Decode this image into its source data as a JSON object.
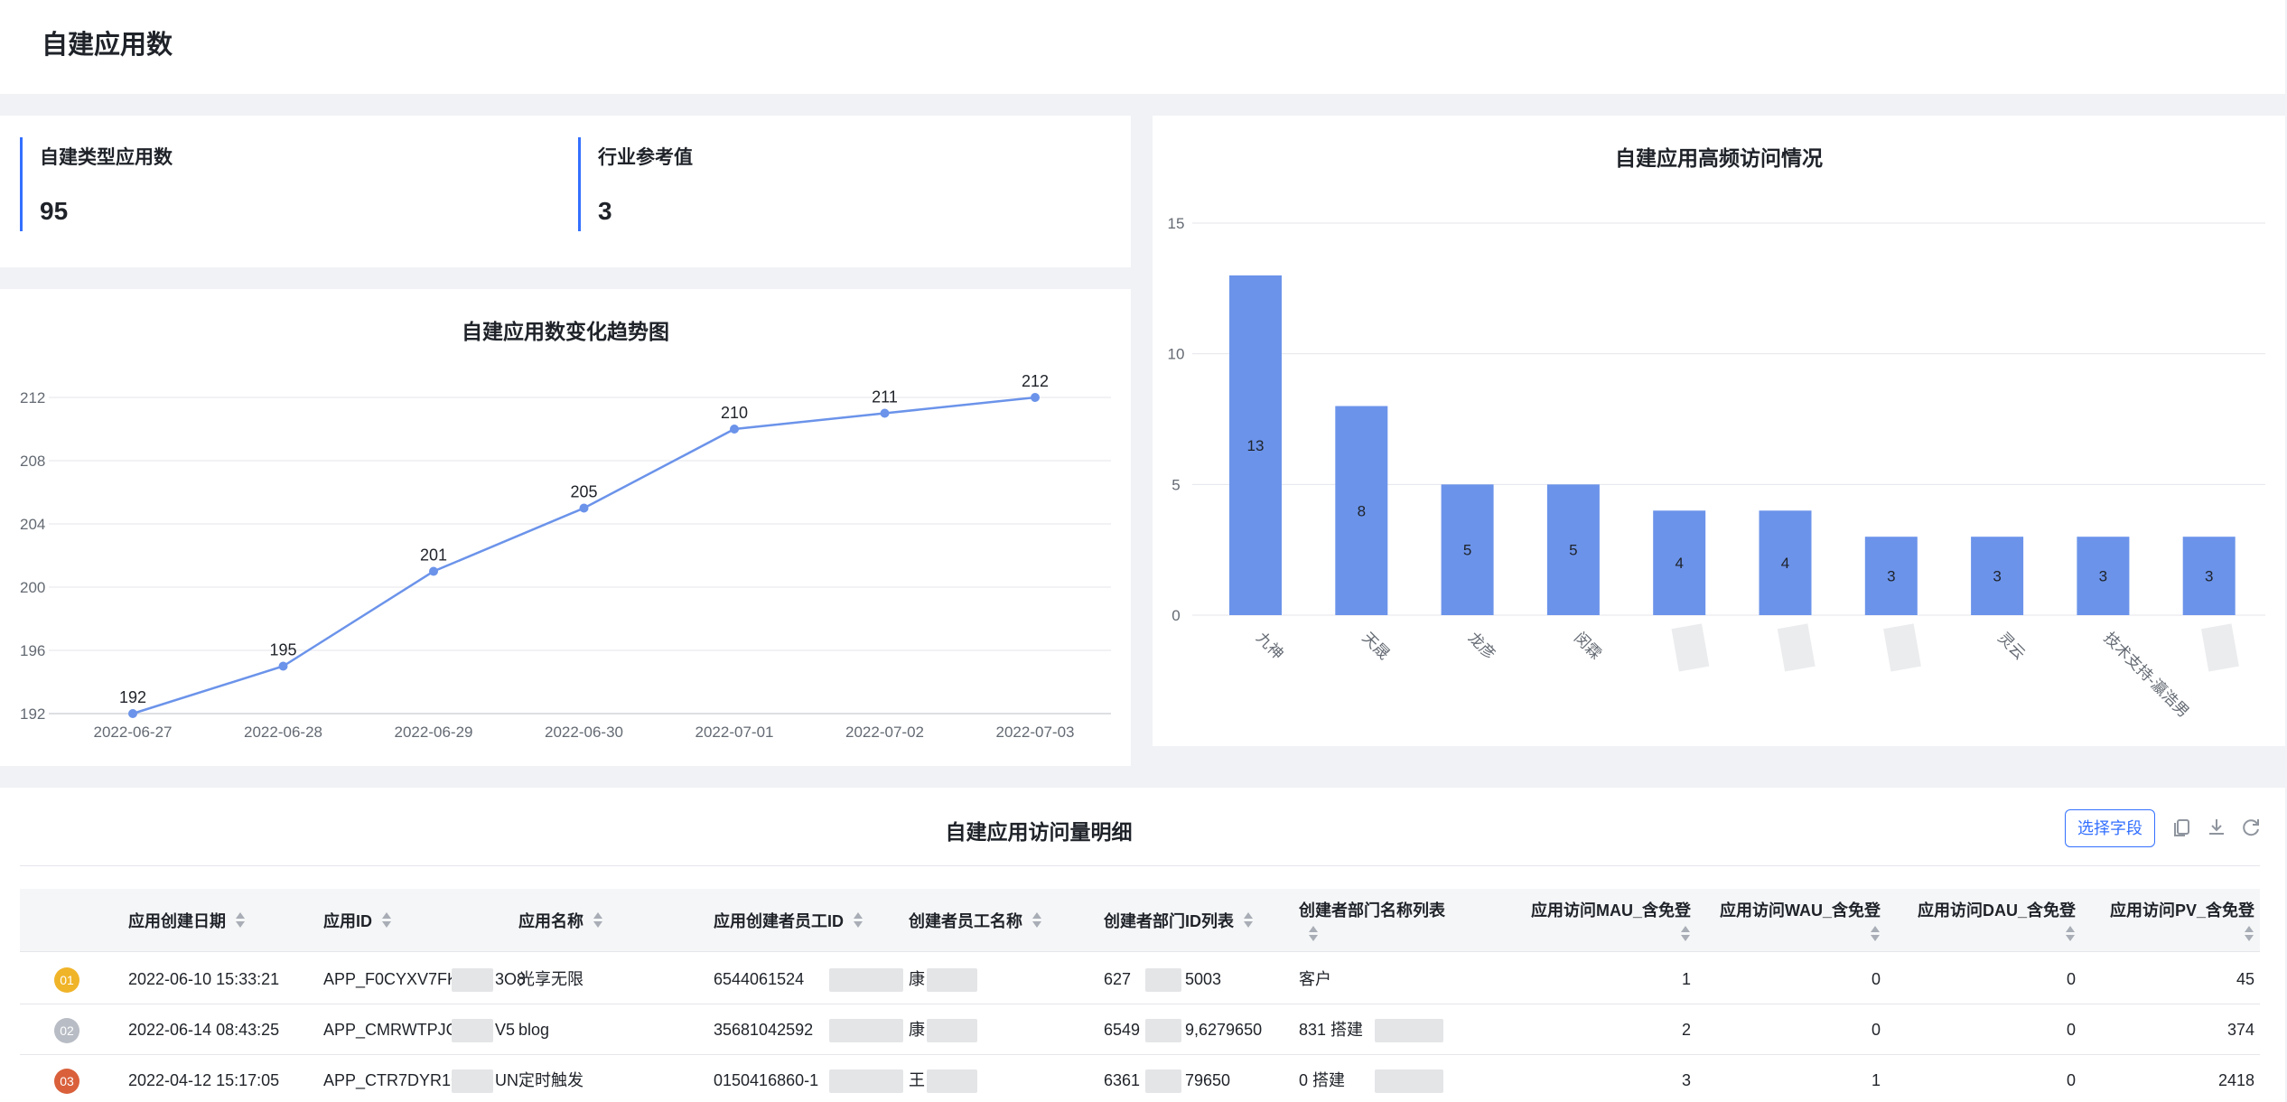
{
  "header": {
    "title": "自建应用数"
  },
  "kpis": [
    {
      "label": "自建类型应用数",
      "value": "95"
    },
    {
      "label": "行业参考值",
      "value": "3"
    }
  ],
  "line_chart": {
    "title": "自建应用数变化趋势图",
    "chart_data": {
      "type": "line",
      "x": [
        "2022-06-27",
        "2022-06-28",
        "2022-06-29",
        "2022-06-30",
        "2022-07-01",
        "2022-07-02",
        "2022-07-03"
      ],
      "values": [
        192,
        195,
        201,
        205,
        210,
        211,
        212
      ],
      "y_ticks": [
        192,
        196,
        200,
        204,
        208,
        212
      ],
      "ylim": [
        192,
        212
      ],
      "grid": true,
      "color": "#6b93ea"
    }
  },
  "bar_chart": {
    "title": "自建应用高频访问情况",
    "chart_data": {
      "type": "bar",
      "categories": [
        "九神",
        "天晟",
        "龙彦",
        "闵霖",
        "",
        "",
        "",
        "灵云",
        "技术支持-瀛浩男",
        ""
      ],
      "values": [
        13,
        8,
        5,
        5,
        4,
        4,
        3,
        3,
        3,
        3
      ],
      "y_ticks": [
        0,
        5,
        10,
        15
      ],
      "ylim": [
        0,
        15
      ],
      "grid": true,
      "color": "#6b93ea"
    }
  },
  "table": {
    "title": "自建应用访问量明细",
    "select_button": "选择字段",
    "icons": [
      "copy-icon",
      "download-icon",
      "refresh-icon"
    ],
    "columns": [
      "应用创建日期",
      "应用ID",
      "应用名称",
      "应用创建者员工ID",
      "创建者员工名称",
      "创建者部门ID列表",
      "创建者部门名称列表",
      "应用访问MAU_含免登",
      "应用访问WAU_含免登",
      "应用访问DAU_含免登",
      "应用访问PV_含免登"
    ],
    "rows": [
      {
        "rank": "01",
        "rank_color": "#f0b429",
        "date": "2022-06-10 15:33:21",
        "app_id": "APP_F0CYXV7FK",
        "app_id_tail": "3O8",
        "name": "光享无限",
        "creator_id": "6544061524",
        "creator_name": "康",
        "dept_id": "627",
        "dept_id_tail": "5003",
        "dept_name": "客户",
        "mau": "1",
        "wau": "0",
        "dau": "0",
        "pv": "45"
      },
      {
        "rank": "02",
        "rank_color": "#b8bcc4",
        "date": "2022-06-14 08:43:25",
        "app_id": "APP_CMRWTPJGS",
        "app_id_tail": "V5",
        "name": "blog",
        "creator_id": "35681042592",
        "creator_name": "康",
        "dept_id": "6549",
        "dept_id_tail": "9,6279650",
        "dept_name": "831 搭建",
        "mau": "2",
        "wau": "0",
        "dau": "0",
        "pv": "374"
      },
      {
        "rank": "03",
        "rank_color": "#d9603b",
        "date": "2022-04-12 15:17:05",
        "app_id": "APP_CTR7DYR1C",
        "app_id_tail": "UN",
        "name": "定时触发",
        "creator_id": "0150416860-1",
        "creator_name": "王",
        "dept_id": "6361",
        "dept_id_tail": "79650",
        "dept_name": "0 搭建",
        "mau": "3",
        "wau": "1",
        "dau": "0",
        "pv": "2418"
      }
    ]
  }
}
